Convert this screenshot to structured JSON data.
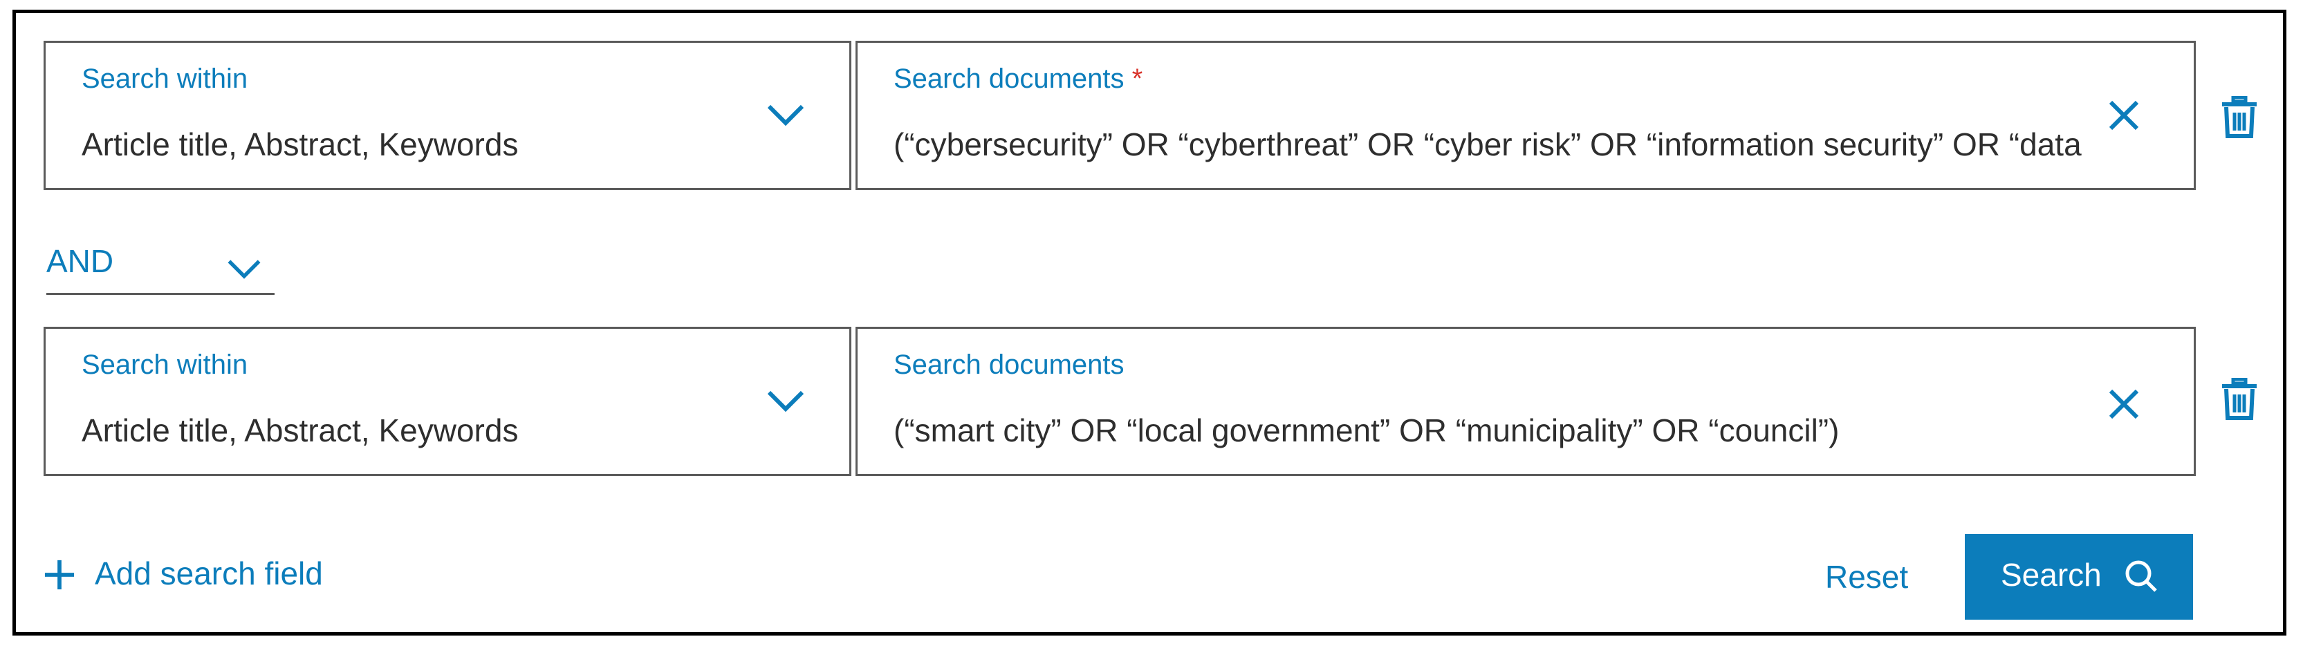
{
  "colors": {
    "accent": "#0c7dbb",
    "required": "#d9342b",
    "text": "#2e2e2e",
    "border": "#5b5b5b"
  },
  "rows": [
    {
      "within_label": "Search within",
      "within_value": "Article title, Abstract, Keywords",
      "documents_label": "Search documents",
      "required_marker": "*",
      "query": "(“cybersecurity” OR “cyberthreat” OR “cyber risk” OR “information security” OR “data"
    },
    {
      "within_label": "Search within",
      "within_value": "Article title, Abstract, Keywords",
      "documents_label": "Search documents",
      "required_marker": "",
      "query": "(“smart city” OR “local government” OR “municipality” OR “council”)"
    }
  ],
  "operator": {
    "value": "AND"
  },
  "actions": {
    "add_field": "Add search field",
    "reset": "Reset",
    "search": "Search"
  },
  "icons": {
    "dropdown": "chevron-down-icon",
    "clear": "close-icon",
    "delete": "trash-icon",
    "add": "plus-icon",
    "search": "magnifier-icon"
  }
}
